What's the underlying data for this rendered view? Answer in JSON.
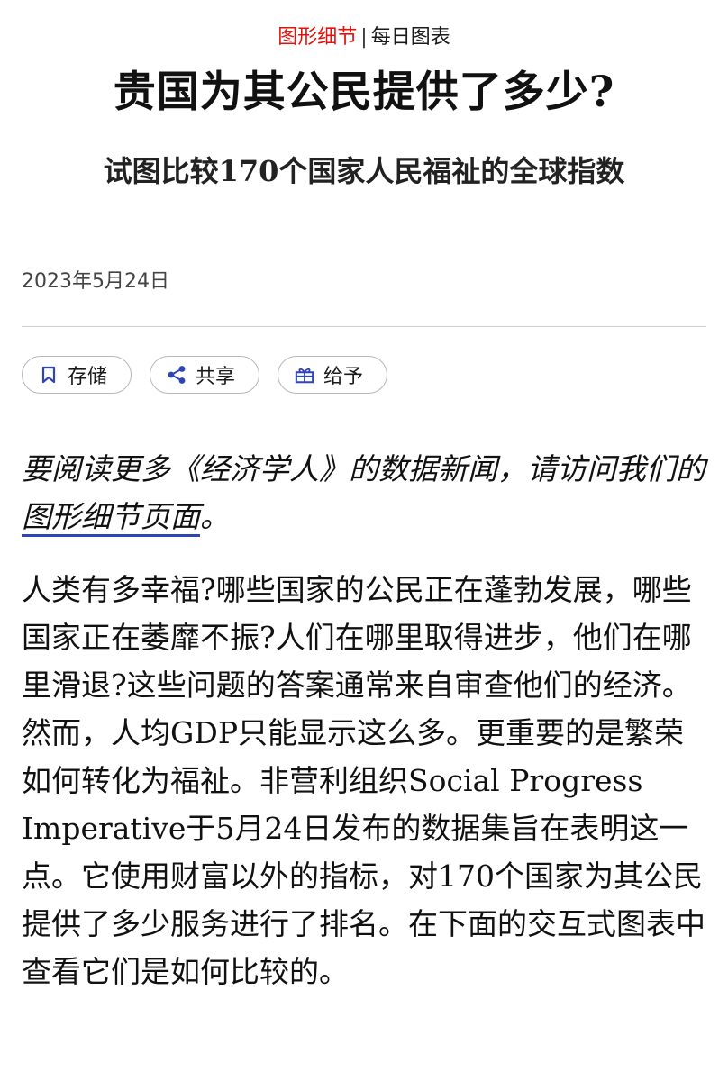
{
  "kicker": {
    "section": "图形细节",
    "separator": "|",
    "series": "每日图表"
  },
  "headline": "贵国为其公民提供了多少?",
  "subheadline": "试图比较170个国家人民福祉的全球指数",
  "date": "2023年5月24日",
  "actions": {
    "save": {
      "label": "存储",
      "icon": "bookmark-icon"
    },
    "share": {
      "label": "共享",
      "icon": "share-icon"
    },
    "gift": {
      "label": "给予",
      "icon": "gift-icon"
    }
  },
  "promo": {
    "before": "要阅读更多《经济学人》的数据新闻，请访问我们的",
    "link": "图形细节页面",
    "after": "。"
  },
  "body": "人类有多幸福?哪些国家的公民正在蓬勃发展，哪些国家正在萎靡不振?人们在哪里取得进步，他们在哪里滑退?这些问题的答案通常来自审查他们的经济。然而，人均GDP只能显示这么多。更重要的是繁荣如何转化为福祉。非营利组织Social Progress Imperative于5月24日发布的数据集旨在表明这一点。它使用财富以外的指标，对170个国家为其公民提供了多少服务进行了排名。在下面的交互式图表中查看它们是如何比较的。",
  "colors": {
    "kicker_red": "#e3120b",
    "link_underline": "#2e45b8",
    "icon_blue": "#2e45b8"
  }
}
